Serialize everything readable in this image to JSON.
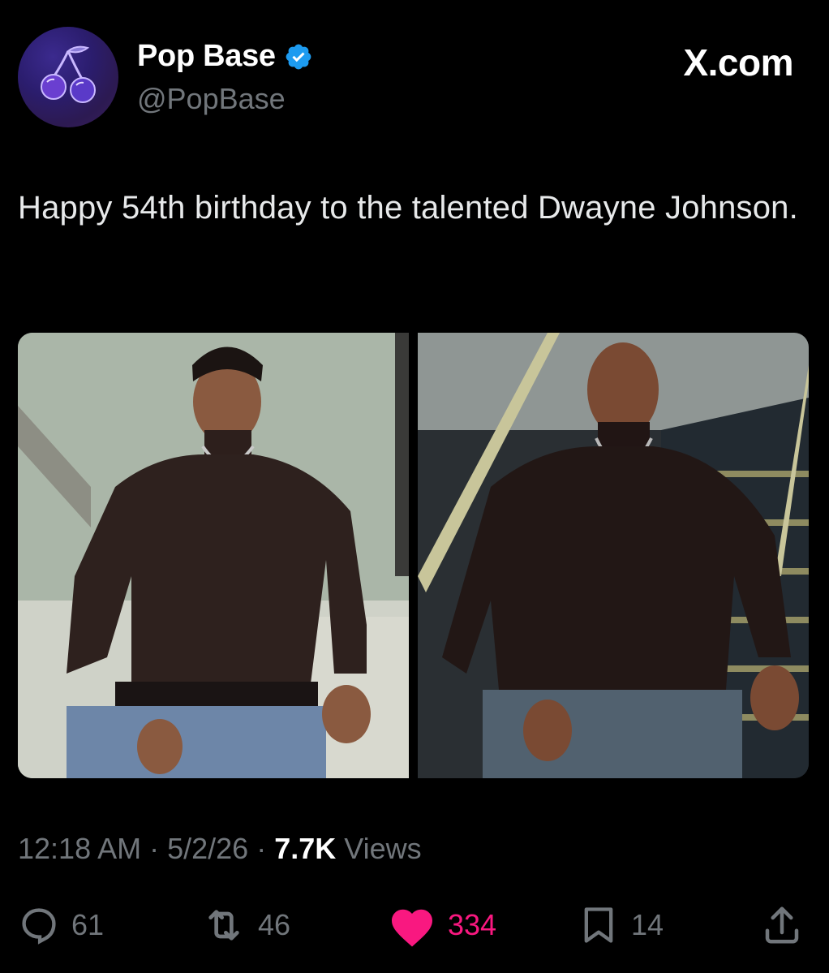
{
  "author": {
    "display_name": "Pop Base",
    "handle": "@PopBase",
    "verified": true,
    "avatar_icon": "cherries-icon"
  },
  "site_label": "X.com",
  "tweet": {
    "text": "Happy 54th birthday to the talented Dwayne Johnson."
  },
  "media": [
    {
      "icon": "photo-1"
    },
    {
      "icon": "photo-2"
    }
  ],
  "meta": {
    "time": "12:18 AM",
    "separator": " · ",
    "date": "5/2/26",
    "views_count": "7.7K",
    "views_label": " Views"
  },
  "actions": {
    "reply": {
      "icon": "reply-icon",
      "count": "61"
    },
    "repost": {
      "icon": "repost-icon",
      "count": "46"
    },
    "like": {
      "icon": "heart-icon",
      "count": "334",
      "color": "#f91880"
    },
    "bookmark": {
      "icon": "bookmark-icon",
      "count": "14"
    },
    "share": {
      "icon": "share-icon"
    }
  },
  "colors": {
    "background": "#000000",
    "text": "#e7e9ea",
    "muted": "#71767b",
    "verified_badge": "#1d9bf0",
    "like": "#f91880"
  }
}
